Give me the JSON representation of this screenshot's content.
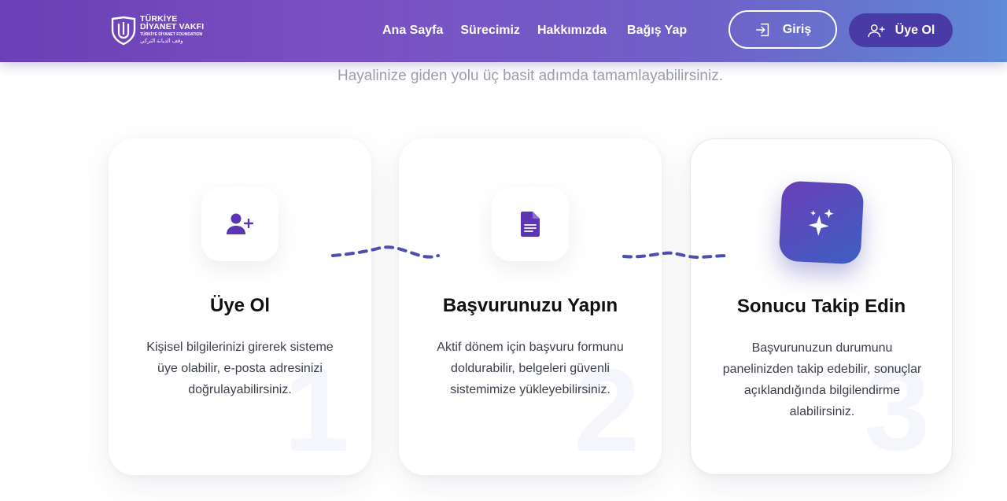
{
  "brand": {
    "line1": "TÜRKİYE",
    "line2": "DİYANET VAKFI",
    "line3": "TÜRKİYE DİYANET FOUNDATION",
    "line4": "وقف الديانة التركي"
  },
  "nav": {
    "links": [
      "Ana Sayfa",
      "Sürecimiz",
      "Hakkımızda",
      "Bağış Yap"
    ],
    "login_label": "Giriş",
    "signup_label": "Üye Ol"
  },
  "section": {
    "subtitle": "Hayalinize giden yolu üç basit adımda tamamlayabilirsiniz."
  },
  "steps": [
    {
      "number": "1",
      "icon": "user-plus-icon",
      "title": "Üye Ol",
      "text": "Kişisel bilgilerinizi girerek sisteme üye olabilir, e-posta adresinizi doğrulayabilirsiniz."
    },
    {
      "number": "2",
      "icon": "document-icon",
      "title": "Başvurunuzu Yapın",
      "text": "Aktif dönem için başvuru formunu doldurabilir, belgeleri güvenli sistemimize yükleyebilirsiniz."
    },
    {
      "number": "3",
      "icon": "sparkles-icon",
      "title": "Sonucu Takip Edin",
      "text": "Başvurunuzun durumunu panelinizden takip edebilir, sonuçlar açıklandığında bilgilendirme alabilirsiniz."
    }
  ],
  "colors": {
    "accent": "#5b36b0",
    "gradient_start": "#6b3fb5",
    "gradient_end": "#5e8ad6",
    "connector": "#4a4fb0"
  }
}
